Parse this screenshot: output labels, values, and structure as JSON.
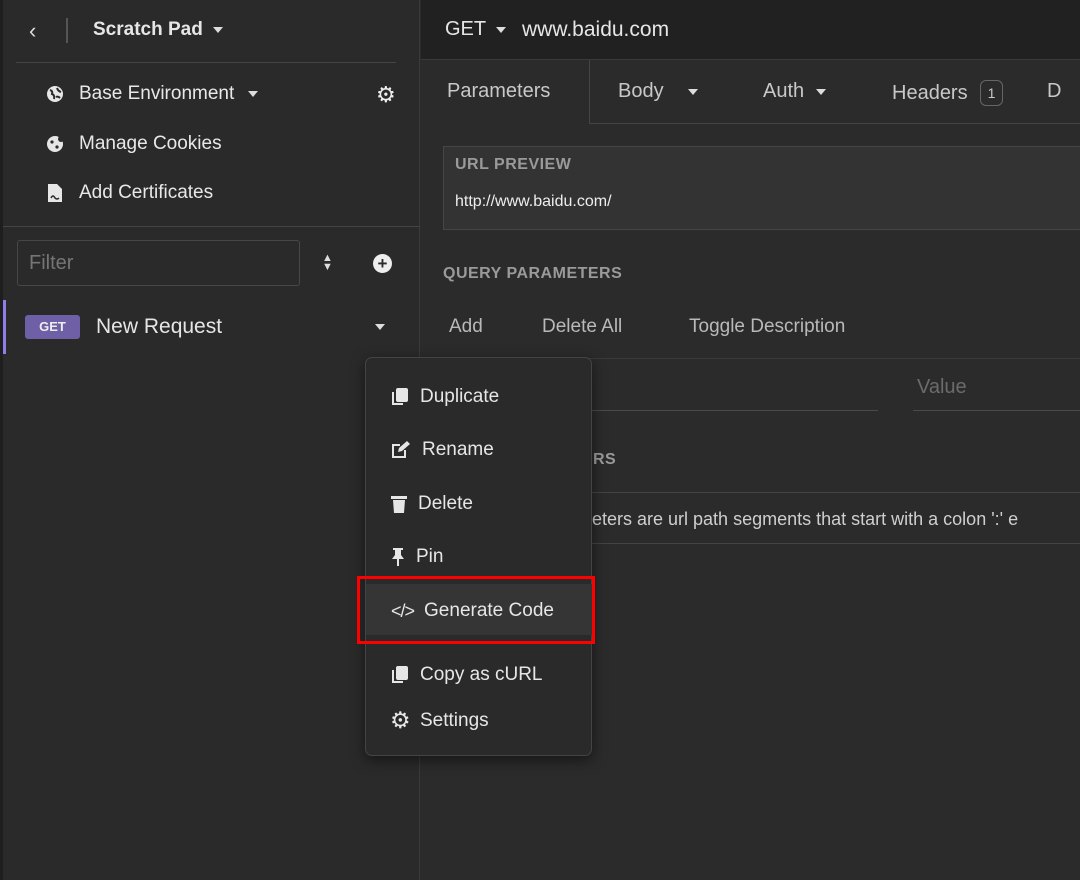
{
  "sidebar": {
    "workspace": "Scratch Pad",
    "environment": "Base Environment",
    "manage_cookies": "Manage Cookies",
    "add_certificates": "Add Certificates",
    "filter_placeholder": "Filter",
    "request": {
      "method": "GET",
      "name": "New Request",
      "method_color": "#6e5fa6",
      "active_color": "#8f7ee8"
    }
  },
  "request_bar": {
    "method": "GET",
    "url": "www.baidu.com"
  },
  "tabs": [
    {
      "label": "Parameters"
    },
    {
      "label": "Body"
    },
    {
      "label": "Auth"
    },
    {
      "label": "Headers",
      "badge": "1"
    },
    {
      "label": "D"
    }
  ],
  "url_preview": {
    "label": "URL PREVIEW",
    "value": "http://www.baidu.com/"
  },
  "query": {
    "label": "QUERY PARAMETERS",
    "add": "Add",
    "delete_all": "Delete All",
    "toggle_description": "Toggle Description",
    "value_placeholder": "Value"
  },
  "path": {
    "label_fragment": "RS",
    "hint_fragment": "eters are url path segments that start with a colon ':' e"
  },
  "context_menu": {
    "items": [
      {
        "label": "Duplicate",
        "icon": "duplicate-icon"
      },
      {
        "label": "Rename",
        "icon": "edit-icon"
      },
      {
        "label": "Delete",
        "icon": "trash-icon"
      },
      {
        "label": "Pin",
        "icon": "pin-icon"
      },
      {
        "label": "Generate Code",
        "icon": "code-icon",
        "highlighted": true
      },
      {
        "label": "Copy as cURL",
        "icon": "copy-icon"
      },
      {
        "label": "Settings",
        "icon": "gear-icon"
      }
    ],
    "highlight_color": "#ff0000"
  }
}
